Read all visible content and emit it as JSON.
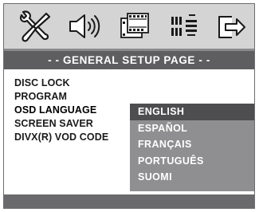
{
  "icons": [
    {
      "name": "tools-settings-icon"
    },
    {
      "name": "speaker-audio-icon"
    },
    {
      "name": "film-video-icon"
    },
    {
      "name": "display-grid-icon"
    },
    {
      "name": "exit-arrow-icon"
    }
  ],
  "title": "- -  GENERAL  SETUP  PAGE  - -",
  "menu": {
    "items": [
      {
        "label": "DISC LOCK"
      },
      {
        "label": "PROGRAM"
      },
      {
        "label": "OSD LANGUAGE"
      },
      {
        "label": "SCREEN SAVER"
      },
      {
        "label": "DIVX(R) VOD CODE"
      }
    ],
    "selected_index": 2
  },
  "options": {
    "items": [
      {
        "label": "ENGLISH"
      },
      {
        "label": "ESPAÑOL"
      },
      {
        "label": "FRANÇAIS"
      },
      {
        "label": "PORTUGUÊS"
      },
      {
        "label": "SUOMI"
      }
    ],
    "active_index": 0
  },
  "colors": {
    "icon_bar": "#d4d4d4",
    "title_bar": "#5e5e60",
    "option_panel": "#8f8f91",
    "option_active": "#4e4e50",
    "bottom_bar": "#6a6a6c"
  }
}
